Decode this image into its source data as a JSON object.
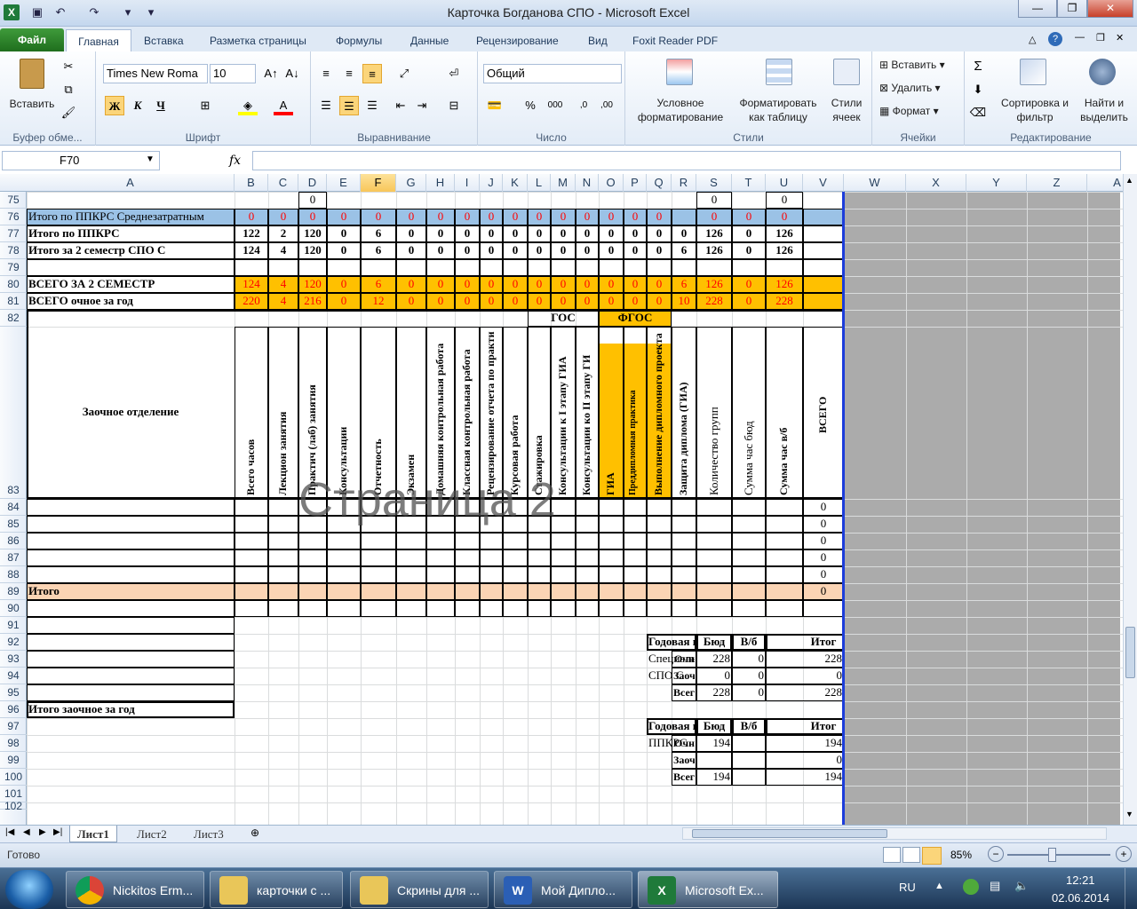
{
  "window": {
    "title": "Карточка Богданова СПО  -  Microsoft Excel"
  },
  "ribbon_tabs": [
    "Файл",
    "Главная",
    "Вставка",
    "Разметка страницы",
    "Формулы",
    "Данные",
    "Рецензирование",
    "Вид",
    "Foxit Reader PDF"
  ],
  "ribbon": {
    "paste_label": "Вставить",
    "clipboard_group": "Буфер обме...",
    "font_name": "Times New Roma",
    "font_size": "10",
    "bold": "Ж",
    "italic": "К",
    "underline": "Ч",
    "font_group": "Шрифт",
    "align_group": "Выравнивание",
    "number_format": "Общий",
    "number_group": "Число",
    "cond_format": "Условное форматирование",
    "format_table": "Форматировать как таблицу",
    "cell_styles": "Стили ячеек",
    "styles_group": "Стили",
    "insert": "Вставить",
    "delete": "Удалить",
    "format": "Формат",
    "cells_group": "Ячейки",
    "sort_filter": "Сортировка и фильтр",
    "find_select": "Найти и выделить",
    "editing_group": "Редактирование"
  },
  "formula_bar": {
    "name_box": "F70",
    "fx": "fx",
    "value": ""
  },
  "columns": [
    "A",
    "B",
    "C",
    "D",
    "E",
    "F",
    "G",
    "H",
    "I",
    "J",
    "K",
    "L",
    "M",
    "N",
    "O",
    "P",
    "Q",
    "R",
    "S",
    "T",
    "U",
    "V",
    "W",
    "X",
    "Y",
    "Z",
    "A"
  ],
  "rows": [
    "75",
    "76",
    "77",
    "78",
    "79",
    "80",
    "81",
    "82",
    "83",
    "84",
    "85",
    "86",
    "87",
    "88",
    "89",
    "90",
    "91",
    "92",
    "93",
    "94",
    "95",
    "96",
    "97",
    "98",
    "99",
    "100",
    "101",
    "102"
  ],
  "cells": {
    "r75": {
      "D": "0",
      "S": "0",
      "U": "0"
    },
    "r76": {
      "A": "Итого по ППКРС Среднезатратным",
      "vals": [
        "0",
        "0",
        "0",
        "0",
        "0",
        "0",
        "0",
        "0",
        "0",
        "0",
        "0",
        "0",
        "0",
        "0",
        "0",
        "0",
        "",
        "0",
        "0",
        "0"
      ]
    },
    "r77": {
      "A": "Итого по ППКРС",
      "vals": [
        "122",
        "2",
        "120",
        "0",
        "6",
        "0",
        "0",
        "0",
        "0",
        "0",
        "0",
        "0",
        "0",
        "0",
        "0",
        "0",
        "0",
        "126",
        "0",
        "126"
      ]
    },
    "r78": {
      "A": "Итого за 2 семестр СПО С",
      "vals": [
        "124",
        "4",
        "120",
        "0",
        "6",
        "0",
        "0",
        "0",
        "0",
        "0",
        "0",
        "0",
        "0",
        "0",
        "0",
        "0",
        "6",
        "126",
        "0",
        "126"
      ]
    },
    "r80": {
      "A": "ВСЕГО ЗА 2 СЕМЕСТР",
      "vals": [
        "124",
        "4",
        "120",
        "0",
        "6",
        "0",
        "0",
        "0",
        "0",
        "0",
        "0",
        "0",
        "0",
        "0",
        "0",
        "0",
        "6",
        "126",
        "0",
        "126"
      ]
    },
    "r81": {
      "A": "ВСЕГО очное за год",
      "vals": [
        "220",
        "4",
        "216",
        "0",
        "12",
        "0",
        "0",
        "0",
        "0",
        "0",
        "0",
        "0",
        "0",
        "0",
        "0",
        "0",
        "10",
        "228",
        "0",
        "228"
      ]
    },
    "gos": "ГОС",
    "fgos": "ФГОС",
    "r83_a": "Заочное отделение",
    "headers": [
      "Всего часов",
      "Лекцион занятия",
      "Практич (лаб) занятия",
      "Консультации",
      "Отчетность",
      "Экзамен",
      "Домашняя контрольная работа",
      "Классная контрольная работа",
      "Рецензирование отчета по практи",
      "Курсовая работа",
      "Стажировка",
      "Консультации к I этапу ГИА",
      "Консультации ко II этапу ГИ",
      "ГИА",
      "Преддипломная практика",
      "Выполнение дипломного проекта",
      "Защита диплома (ГИА)",
      "Количество групп",
      "Сумма час бюд",
      "Сумма час в/б",
      "ВСЕГО"
    ],
    "v_zero": "0",
    "r89": "Итого",
    "r96": "Итого заочное за год"
  },
  "summary1": {
    "title": "Годовая нагрузка",
    "h_bud": "Бюд",
    "h_vb": "В/б",
    "h_itog": "Итог",
    "line1": "Специальности",
    "line2": "СПО С",
    "r1_label": "Очн",
    "r1": [
      "228",
      "0",
      "228"
    ],
    "r2_label": "Заоч",
    "r2": [
      "0",
      "0",
      "0"
    ],
    "r3_label": "Всего",
    "r3": [
      "228",
      "0",
      "228"
    ]
  },
  "summary2": {
    "title": "Годовая нагрузка",
    "h_bud": "Бюд",
    "h_vb": "В/б",
    "h_itog": "Итог",
    "line1": "ППКРС",
    "r1_label": "Очн",
    "r1": [
      "194",
      "",
      "194"
    ],
    "r2_label": "Заоч",
    "r2": [
      "",
      "",
      "0"
    ],
    "r3_label": "Всего",
    "r3": [
      "194",
      "",
      "194"
    ]
  },
  "watermark": "Страница 2",
  "sheets": [
    "Лист1",
    "Лист2",
    "Лист3"
  ],
  "status": {
    "ready": "Готово",
    "zoom": "85%"
  },
  "taskbar": {
    "items": [
      "Nickitos Erm...",
      "карточки с ...",
      "Скрины для ...",
      "Мой Дипло...",
      "Microsoft Ex..."
    ],
    "lang": "RU",
    "time": "12:21",
    "date": "02.06.2014"
  },
  "colors": {
    "accent_orange": "#ffc000",
    "peach": "#fbd4b4",
    "blue_row": "#9bc2e6",
    "red_text": "#ff0000"
  }
}
